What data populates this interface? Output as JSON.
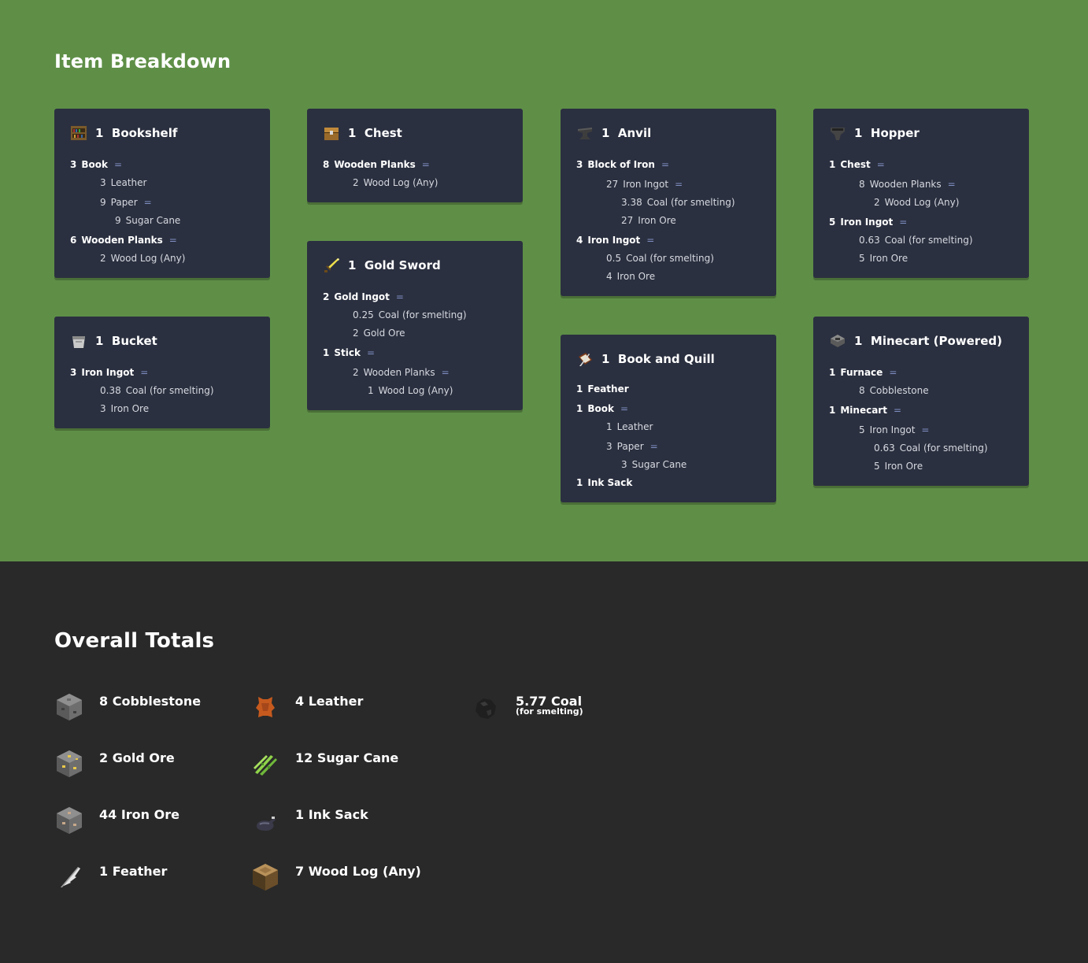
{
  "breakdown": {
    "title": "Item Breakdown",
    "cards": [
      {
        "qty": "1",
        "name": "Bookshelf",
        "icon": "bookshelf-icon",
        "rows": [
          {
            "q": "3",
            "label": "Book",
            "eq": "="
          },
          {
            "q": "3",
            "label": "Leather"
          },
          {
            "q": "9",
            "label": "Paper",
            "eq": "="
          },
          {
            "q": "9",
            "label": "Sugar Cane"
          },
          {
            "q": "6",
            "label": "Wooden Planks",
            "eq": "="
          },
          {
            "q": "2",
            "label": "Wood Log (Any)"
          }
        ]
      },
      {
        "qty": "1",
        "name": "Bucket",
        "icon": "bucket-icon",
        "rows": [
          {
            "q": "3",
            "label": "Iron Ingot",
            "eq": "="
          },
          {
            "q": "0.38",
            "label": "Coal (for smelting)"
          },
          {
            "q": "3",
            "label": "Iron Ore"
          }
        ]
      },
      {
        "qty": "1",
        "name": "Chest",
        "icon": "chest-icon",
        "rows": [
          {
            "q": "8",
            "label": "Wooden Planks",
            "eq": "="
          },
          {
            "q": "2",
            "label": "Wood Log (Any)"
          }
        ]
      },
      {
        "qty": "1",
        "name": "Gold Sword",
        "icon": "gold-sword-icon",
        "rows": [
          {
            "q": "2",
            "label": "Gold Ingot",
            "eq": "="
          },
          {
            "q": "0.25",
            "label": "Coal (for smelting)"
          },
          {
            "q": "2",
            "label": "Gold Ore"
          },
          {
            "q": "1",
            "label": "Stick",
            "eq": "="
          },
          {
            "q": "2",
            "label": "Wooden Planks",
            "eq": "="
          },
          {
            "q": "1",
            "label": "Wood Log (Any)"
          }
        ]
      },
      {
        "qty": "1",
        "name": "Anvil",
        "icon": "anvil-icon",
        "rows": [
          {
            "q": "3",
            "label": "Block of Iron",
            "eq": "="
          },
          {
            "q": "27",
            "label": "Iron Ingot",
            "eq": "="
          },
          {
            "q": "3.38",
            "label": "Coal (for smelting)"
          },
          {
            "q": "27",
            "label": "Iron Ore"
          },
          {
            "q": "4",
            "label": "Iron Ingot",
            "eq": "="
          },
          {
            "q": "0.5",
            "label": "Coal (for smelting)"
          },
          {
            "q": "4",
            "label": "Iron Ore"
          }
        ]
      },
      {
        "qty": "1",
        "name": "Book and Quill",
        "icon": "book-and-quill-icon",
        "rows": [
          {
            "q": "1",
            "label": "Feather"
          },
          {
            "q": "1",
            "label": "Book",
            "eq": "="
          },
          {
            "q": "1",
            "label": "Leather"
          },
          {
            "q": "3",
            "label": "Paper",
            "eq": "="
          },
          {
            "q": "3",
            "label": "Sugar Cane"
          },
          {
            "q": "1",
            "label": "Ink Sack"
          }
        ]
      },
      {
        "qty": "1",
        "name": "Hopper",
        "icon": "hopper-icon",
        "rows": [
          {
            "q": "1",
            "label": "Chest",
            "eq": "="
          },
          {
            "q": "8",
            "label": "Wooden Planks",
            "eq": "="
          },
          {
            "q": "2",
            "label": "Wood Log (Any)"
          },
          {
            "q": "5",
            "label": "Iron Ingot",
            "eq": "="
          },
          {
            "q": "0.63",
            "label": "Coal (for smelting)"
          },
          {
            "q": "5",
            "label": "Iron Ore"
          }
        ]
      },
      {
        "qty": "1",
        "name": "Minecart (Powered)",
        "icon": "powered-minecart-icon",
        "rows": [
          {
            "q": "1",
            "label": "Furnace",
            "eq": "="
          },
          {
            "q": "8",
            "label": "Cobblestone"
          },
          {
            "q": "1",
            "label": "Minecart",
            "eq": "="
          },
          {
            "q": "5",
            "label": "Iron Ingot",
            "eq": "="
          },
          {
            "q": "0.63",
            "label": "Coal (for smelting)"
          },
          {
            "q": "5",
            "label": "Iron Ore"
          }
        ]
      }
    ]
  },
  "totals": {
    "title": "Overall Totals",
    "items": [
      {
        "label": "8 Cobblestone",
        "icon": "cobblestone-icon"
      },
      {
        "label": "2 Gold Ore",
        "icon": "gold-ore-icon"
      },
      {
        "label": "44 Iron Ore",
        "icon": "iron-ore-icon"
      },
      {
        "label": "1 Feather",
        "icon": "feather-icon"
      },
      {
        "label": "4 Leather",
        "icon": "leather-icon"
      },
      {
        "label": "12 Sugar Cane",
        "icon": "sugar-cane-icon"
      },
      {
        "label": "1 Ink Sack",
        "icon": "ink-sack-icon"
      },
      {
        "label": "7 Wood Log (Any)",
        "icon": "wood-log-icon"
      },
      {
        "label": "5.77 Coal",
        "sub": "(for smelting)",
        "icon": "coal-icon"
      }
    ]
  }
}
